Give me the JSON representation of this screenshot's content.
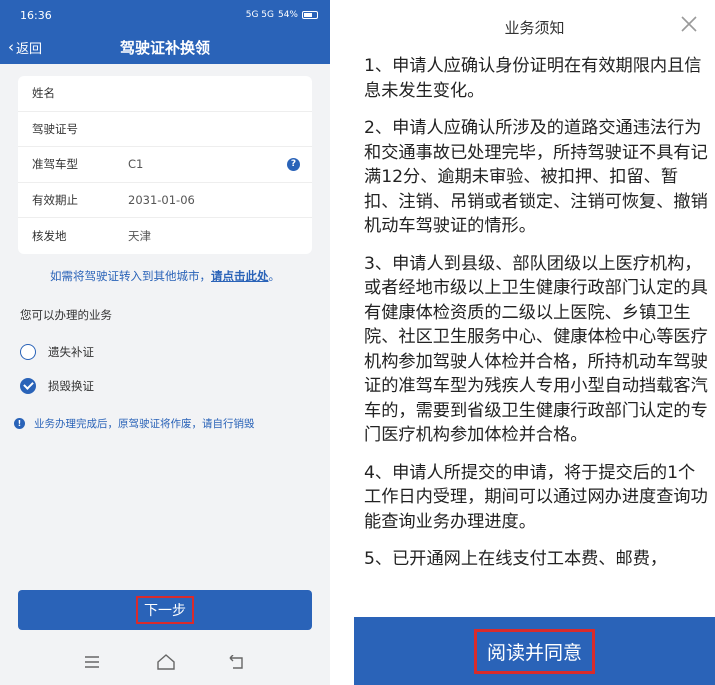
{
  "left": {
    "status": {
      "time": "16:36",
      "signal_text": "5G 5G",
      "battery": "54%"
    },
    "appbar": {
      "back_label": "返回",
      "title": "驾驶证补换领"
    },
    "info_rows": [
      {
        "label": "姓名",
        "value": ""
      },
      {
        "label": "驾驶证号",
        "value": ""
      },
      {
        "label": "准驾车型",
        "value": "C1",
        "help_icon": "?"
      },
      {
        "label": "有效期止",
        "value": "2031-01-06"
      },
      {
        "label": "核发地",
        "value": "天津"
      }
    ],
    "transfer": {
      "text": "如需将驾驶证转入到其他城市，",
      "link": "请点击此处",
      "end": "。"
    },
    "section_title": "您可以办理的业务",
    "options": [
      {
        "label": "遗失补证",
        "checked": false
      },
      {
        "label": "损毁换证",
        "checked": true
      }
    ],
    "notice": {
      "icon": "!",
      "text": "业务办理完成后，原驾驶证将作废，请自行销毁"
    },
    "next_button": "下一步",
    "nav_icons": [
      "menu-icon",
      "home-icon",
      "back-icon"
    ]
  },
  "right": {
    "title": "业务须知",
    "close_icon": "close-icon",
    "paragraphs": [
      "1、申请人应确认身份证明在有效期限内且信息未发生变化。",
      "2、申请人应确认所涉及的道路交通违法行为和交通事故已处理完毕，所持驾驶证不具有记满12分、逾期未审验、被扣押、扣留、暂扣、注销、吊销或者锁定、注销可恢复、撤销机动车驾驶证的情形。",
      "3、申请人到县级、部队团级以上医疗机构，或者经地市级以上卫生健康行政部门认定的具有健康体检资质的二级以上医院、乡镇卫生院、社区卫生服务中心、健康体检中心等医疗机构参加驾驶人体检并合格，所持机动车驾驶证的准驾车型为残疾人专用小型自动挡载客汽车的，需要到省级卫生健康行政部门认定的专门医疗机构参加体检并合格。",
      "4、申请人所提交的申请，将于提交后的1个工作日内受理，期间可以通过网办进度查询功能查询业务办理进度。",
      "5、已开通网上在线支付工本费、邮费，"
    ],
    "agree_button": "阅读并同意"
  },
  "colors": {
    "brand": "#2a63b8",
    "highlight": "#d92b2b"
  }
}
